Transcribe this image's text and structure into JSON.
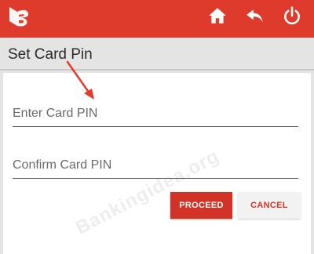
{
  "topbar": {
    "color": "#de3b2c",
    "logo_icon": "bank-of-baroda-logo",
    "icons": [
      "home-icon",
      "back-icon",
      "power-icon"
    ]
  },
  "title": "Set Card Pin",
  "form": {
    "enter_pin_placeholder": "Enter Card PIN",
    "confirm_pin_placeholder": "Confirm Card PIN",
    "enter_pin_value": "",
    "confirm_pin_value": ""
  },
  "buttons": {
    "proceed_label": "PROCEED",
    "cancel_label": "CANCEL"
  },
  "watermark": "Bankingidea.org",
  "annotation": {
    "arrow_color": "#e53a2c"
  }
}
